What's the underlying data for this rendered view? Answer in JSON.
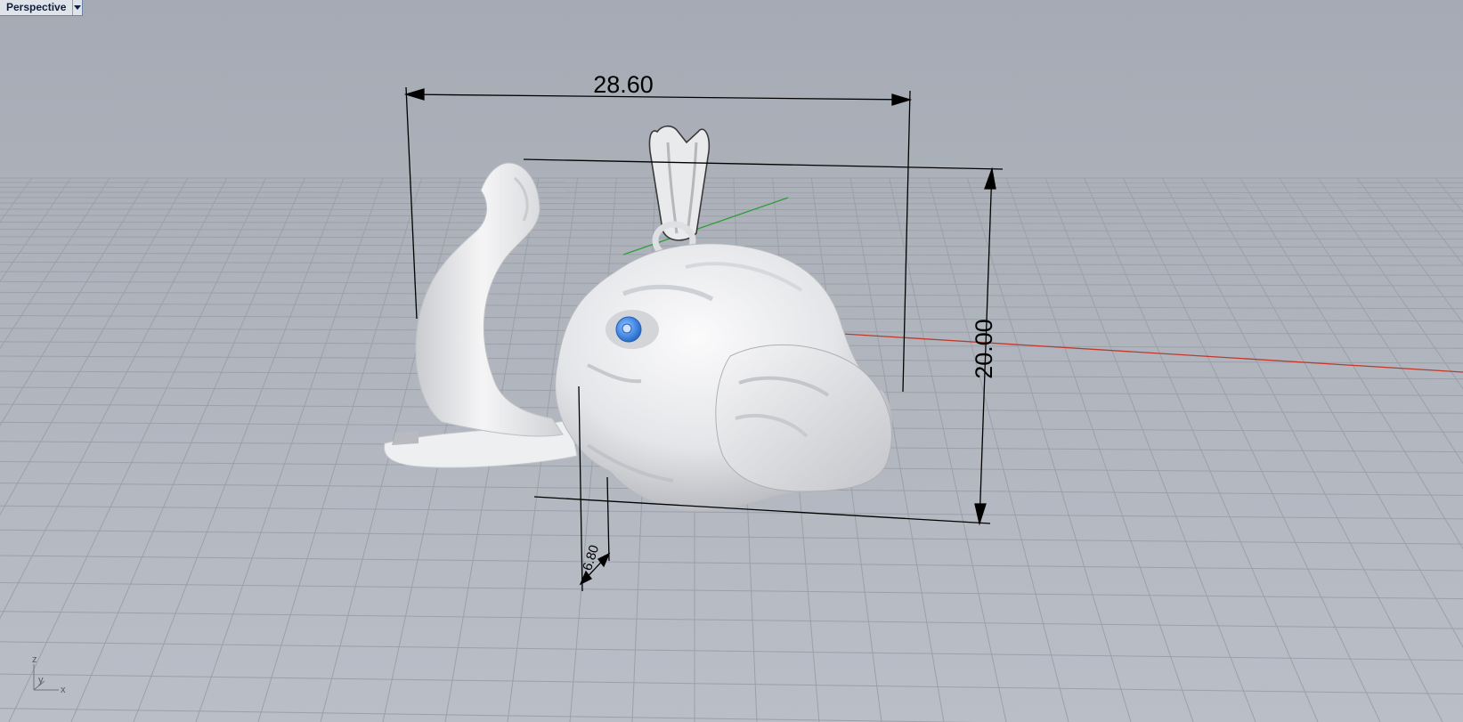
{
  "viewport": {
    "name": "Perspective"
  },
  "dimensions": {
    "width": "28.60",
    "height": "20.00",
    "depth": "6.80"
  },
  "axis_widget": {
    "z": "z",
    "y": "y",
    "x": "x"
  },
  "colors": {
    "background": "#aeb3bc",
    "grid_line": "#9ba0a9",
    "x_axis": "#c0392b",
    "y_axis": "#2e9e3a",
    "model": "#e6e7e9",
    "eye": "#4a8fe8",
    "dimension_line": "#000000"
  },
  "icons": {
    "viewport_menu": "chevron-down-icon"
  }
}
